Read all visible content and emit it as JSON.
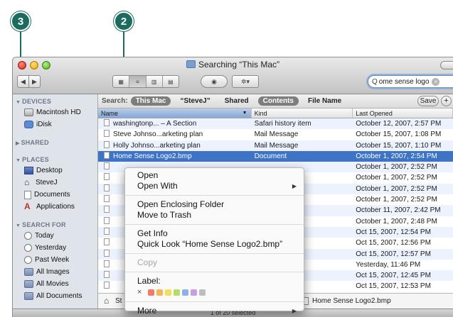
{
  "callouts": [
    "3",
    "2"
  ],
  "window": {
    "title": "Searching “This Mac”",
    "search_value": "ome sense logo"
  },
  "toolbar": {
    "back_icon": "◀",
    "forward_icon": "▶",
    "view_icons": [
      "▦",
      "≡",
      "▥",
      "▤"
    ],
    "quicklook_icon": "◉",
    "action_icon": "✲▾"
  },
  "sidebar": {
    "devices": {
      "title": "DEVICES",
      "items": [
        "Macintosh HD",
        "iDisk"
      ]
    },
    "shared": {
      "title": "SHARED"
    },
    "places": {
      "title": "PLACES",
      "items": [
        "Desktop",
        "SteveJ",
        "Documents",
        "Applications"
      ]
    },
    "search_for": {
      "title": "SEARCH FOR",
      "items": [
        "Today",
        "Yesterday",
        "Past Week",
        "All Images",
        "All Movies",
        "All Documents"
      ]
    }
  },
  "searchbar": {
    "label": "Search:",
    "scopes": [
      "This Mac",
      "“SteveJ”",
      "Shared"
    ],
    "criteria": [
      "Contents",
      "File Name"
    ],
    "save_label": "Save",
    "plus_label": "+"
  },
  "columns": [
    "Name",
    "Kind",
    "Last Opened"
  ],
  "rows": [
    {
      "name": "washingtonp... – A Section",
      "kind": "Safari history item",
      "date": "October 12, 2007, 2:57 PM"
    },
    {
      "name": "Steve Johnso...arketing plan",
      "kind": "Mail Message",
      "date": "October 15, 2007, 1:08 PM"
    },
    {
      "name": "Holly Johnso...arketing plan",
      "kind": "Mail Message",
      "date": "October 15, 2007, 1:10 PM"
    },
    {
      "name": "Home Sense Logo2.bmp",
      "kind": "Document",
      "date": "October 1, 2007, 2:54 PM"
    },
    {
      "name": "",
      "kind": "",
      "date": "October 1, 2007, 2:52 PM"
    },
    {
      "name": "",
      "kind": "",
      "date": "October 1, 2007, 2:52 PM"
    },
    {
      "name": "",
      "kind": "",
      "date": "October 1, 2007, 2:52 PM"
    },
    {
      "name": "",
      "kind": "",
      "date": "October 1, 2007, 2:52 PM"
    },
    {
      "name": "",
      "kind": "",
      "date": "October 11, 2007, 2:42 PM"
    },
    {
      "name": "",
      "kind": "",
      "date": "October 1, 2007, 2:48 PM"
    },
    {
      "name": "",
      "kind": "",
      "date": "Oct 15, 2007, 12:54 PM"
    },
    {
      "name": "",
      "kind": "",
      "date": "Oct 15, 2007, 12:56 PM"
    },
    {
      "name": "",
      "kind": "",
      "date": "Oct 15, 2007, 12:57 PM"
    },
    {
      "name": "",
      "kind": "",
      "date": "Yesterday, 11:46 PM"
    },
    {
      "name": "",
      "kind": "",
      "date": "Oct 15, 2007, 12:45 PM"
    },
    {
      "name": "",
      "kind": "",
      "date": "Oct 15, 2007, 12:53 PM"
    }
  ],
  "pathbar": {
    "left": "St",
    "file": "Home Sense Logo2.bmp"
  },
  "status": "1 of 20 selected",
  "context_menu": {
    "open": "Open",
    "open_with": "Open With",
    "open_enclosing": "Open Enclosing Folder",
    "move_to_trash": "Move to Trash",
    "get_info": "Get Info",
    "quick_look": "Quick Look “Home Sense Logo2.bmp”",
    "copy": "Copy",
    "label": "Label:",
    "label_none": "×",
    "label_colors": [
      "#f37a6a",
      "#f7b35a",
      "#f2df5d",
      "#b6dc6a",
      "#8fb0ee",
      "#c79ee4",
      "#bdbdbd"
    ],
    "more": "More"
  }
}
